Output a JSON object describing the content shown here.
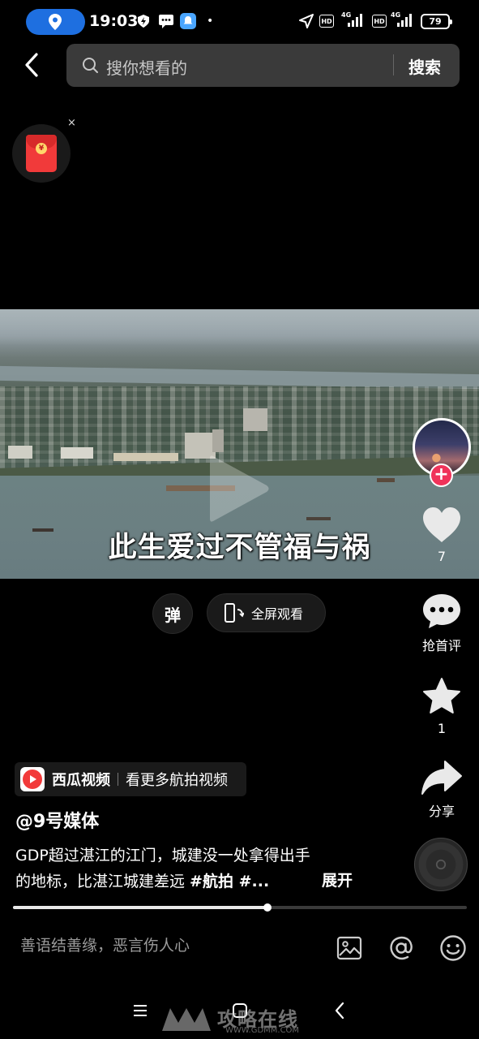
{
  "status_bar": {
    "time": "19:03",
    "hd1": "HD",
    "net1": "4G",
    "hd2": "HD",
    "net2": "4G",
    "battery": "79"
  },
  "search": {
    "placeholder": "搜你想看的",
    "button": "搜索"
  },
  "red_packet": {
    "close": "×",
    "coin": "¥"
  },
  "video": {
    "subtitle": "此生爱过不管福与祸"
  },
  "controls": {
    "danmu": "弹",
    "fullscreen": "全屏观看"
  },
  "rail": {
    "like_count": "7",
    "comment_label": "抢首评",
    "favorite_count": "1",
    "share_label": "分享",
    "follow": "+"
  },
  "info": {
    "app_name": "西瓜视频",
    "more_link": "看更多航拍视频",
    "author": "@9号媒体",
    "desc_line1": "GDP超过湛江的江门，城建没一处拿得出手",
    "desc_line2_text": "的地标，比湛江城建差远 ",
    "desc_tag1": "#航拍",
    "desc_tag2": " #...",
    "expand": "展开"
  },
  "progress": {
    "fraction": 0.56
  },
  "comment_bar": {
    "placeholder": "善语结善缘，恶言伤人心"
  },
  "watermark": {
    "title": "攻略在线",
    "url": "WWW.GDMM.COM"
  },
  "colors": {
    "accent_blue": "#1e6fe0",
    "follow_red": "#f0335a",
    "search_bg": "#3a3a3a"
  }
}
